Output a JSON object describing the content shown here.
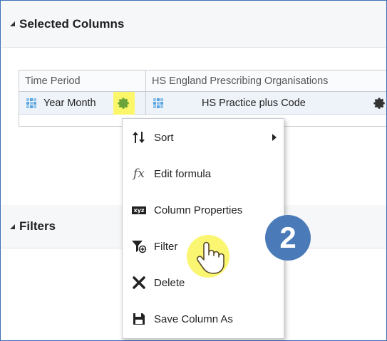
{
  "selected_columns": {
    "title": "Selected Columns",
    "columns": [
      {
        "group": "Time Period",
        "item": "Year Month"
      },
      {
        "group": "HS England Prescribing Organisations",
        "item": "HS Practice plus Code"
      }
    ]
  },
  "filters": {
    "title": "Filters"
  },
  "context_menu": {
    "items": [
      {
        "label": "Sort",
        "icon": "sort-icon",
        "has_submenu": true
      },
      {
        "label": "Edit formula",
        "icon": "fx-icon",
        "icon_text": "fx"
      },
      {
        "label": "Column Properties",
        "icon": "xyz-icon",
        "icon_text": "xyz"
      },
      {
        "label": "Filter",
        "icon": "filter-icon"
      },
      {
        "label": "Delete",
        "icon": "delete-icon"
      },
      {
        "label": "Save Column As",
        "icon": "save-icon"
      }
    ]
  },
  "step_badge": "2",
  "colors": {
    "accent": "#4a7ab8",
    "highlight": "#fbf66a",
    "gear_green": "#6aa43a"
  }
}
